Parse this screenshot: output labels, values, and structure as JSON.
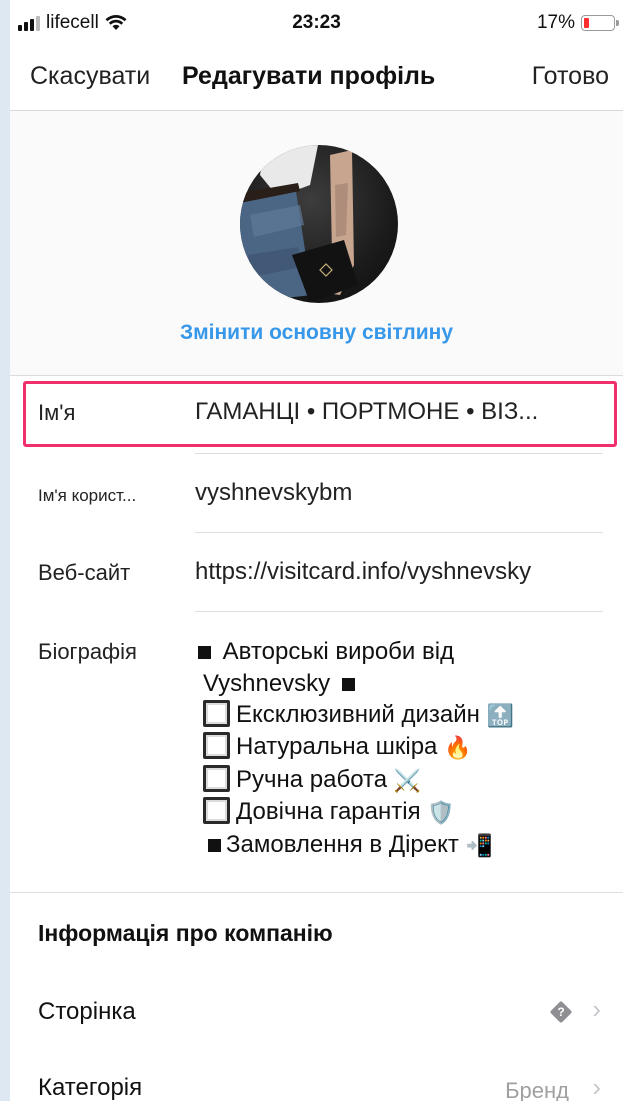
{
  "status_bar": {
    "carrier": "lifecell",
    "time": "23:23",
    "battery_percent": "17%",
    "battery_level": 0.17,
    "signal_bars": 4,
    "signal_active": 3
  },
  "nav": {
    "cancel_label": "Скасувати",
    "title": "Редагувати профіль",
    "done_label": "Готово"
  },
  "photo": {
    "change_label": "Змінити основну світлину"
  },
  "fields": {
    "name": {
      "label": "Ім'я",
      "value": "ГАМАНЦІ • ПОРТМОНЕ • ВІЗ..."
    },
    "username": {
      "label": "Ім'я корист...",
      "value": "vyshnevskybm"
    },
    "website": {
      "label": "Веб-сайт",
      "value": "https://visitcard.info/vyshnevsky"
    },
    "bio": {
      "label": "Біографія",
      "lines": [
        "Авторські вироби від",
        "Vyshnevsky",
        "Ексклюзивний дизайн",
        "Натуральна шкіра",
        "Ручна работа",
        "Довічна гарантія",
        "Замовлення в Дірект"
      ],
      "emoji": {
        "top": "🔝",
        "fire": "🔥",
        "swords": "⚔️",
        "shield": "🛡️",
        "phone": "📲"
      }
    }
  },
  "company": {
    "section_title": "Інформація про компанію",
    "page_label": "Сторінка",
    "page_badge": "?",
    "category_label": "Категорія",
    "category_value": "Бренд",
    "chevron": "›"
  },
  "colors": {
    "accent_blue": "#3797e8",
    "highlight_pink": "#f0306a",
    "battery_red": "#ff2d2d"
  }
}
